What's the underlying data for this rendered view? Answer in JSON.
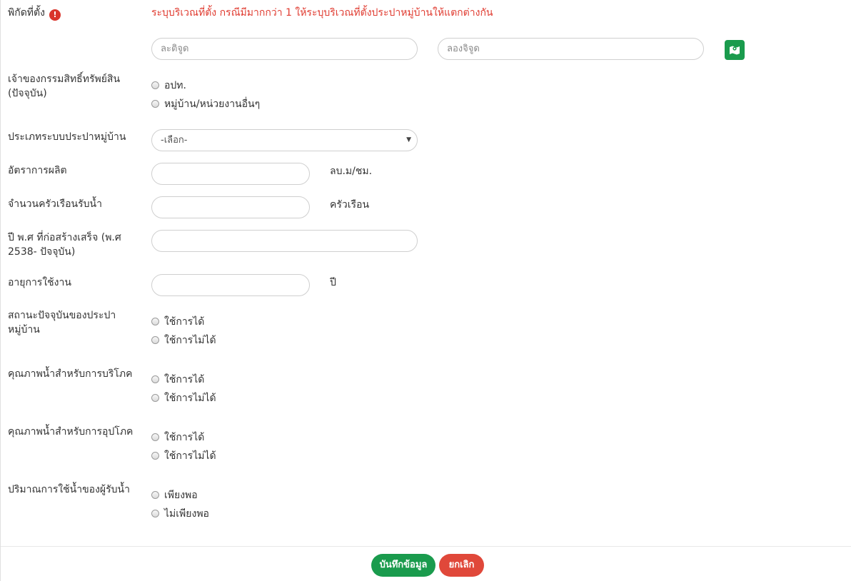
{
  "coordinates": {
    "label": "พิกัดที่ตั้ง",
    "warning_icon": "exclamation-circle-icon",
    "note": "ระบุบริเวณที่ตั้ง กรณีมีมากกว่า 1 ให้ระบุบริเวณที่ตั้งประปาหมู่บ้านให้แตกต่างกัน",
    "latitude_placeholder": "ละติจูด",
    "longitude_placeholder": "ลองจิจูด",
    "map_button_icon": "map-marker-icon"
  },
  "ownership": {
    "label": "เจ้าของกรรมสิทธิ์ทรัพย์สิน (ปัจจุบัน)",
    "options": [
      "อปท.",
      "หมู่บ้าน/หน่วยงานอื่นๆ"
    ]
  },
  "system_type": {
    "label": "ประเภทระบบประปาหมู่บ้าน",
    "selected": "-เลือก-"
  },
  "production_rate": {
    "label": "อัตราการผลิต",
    "value": "",
    "unit": "ลบ.ม/ชม."
  },
  "households": {
    "label": "จำนวนครัวเรือนรับน้ำ",
    "value": "",
    "unit": "ครัวเรือน"
  },
  "build_year": {
    "label": "ปี พ.ศ ที่ก่อสร้างเสร็จ (พ.ศ 2538- ปัจจุบัน)",
    "value": ""
  },
  "service_age": {
    "label": "อายุการใช้งาน",
    "value": "",
    "unit": "ปี"
  },
  "current_status": {
    "label": "สถานะปัจจุบันของประปาหมู่บ้าน",
    "options": [
      "ใช้การได้",
      "ใช้การไม่ได้"
    ]
  },
  "quality_drinking": {
    "label": "คุณภาพน้ำสำหรับการบริโภค",
    "options": [
      "ใช้การได้",
      "ใช้การไม่ได้"
    ]
  },
  "quality_use": {
    "label": "คุณภาพน้ำสำหรับการอุปโภค",
    "options": [
      "ใช้การได้",
      "ใช้การไม่ได้"
    ]
  },
  "water_amount": {
    "label": "ปริมาณการใช้น้ำของผู้รับน้ำ",
    "options": [
      "เพียงพอ",
      "ไม่เพียงพอ"
    ]
  },
  "footer": {
    "save_label": "บันทึกข้อมูล",
    "cancel_label": "ยกเลิก"
  },
  "colors": {
    "accent_green": "#1a9b4d",
    "danger_red": "#e0483a",
    "note_red": "#e03c31"
  }
}
